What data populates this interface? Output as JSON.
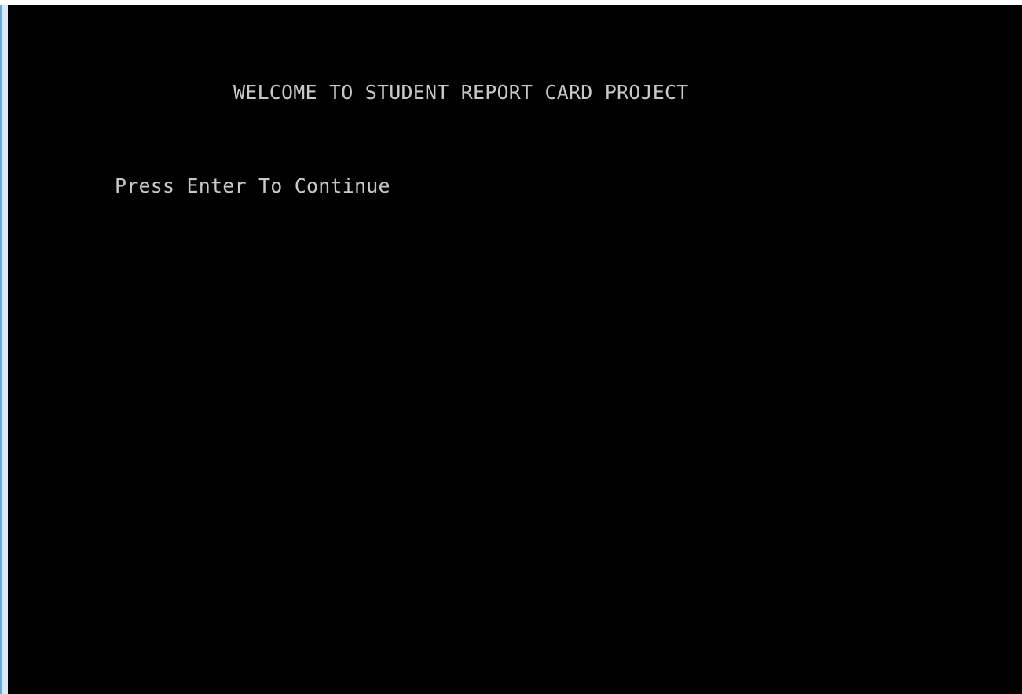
{
  "console": {
    "background_color": "#000000",
    "text_color": "#c8c8c8",
    "lines": {
      "welcome": "WELCOME TO STUDENT REPORT CARD PROJECT",
      "prompt": "Press Enter To Continue"
    }
  }
}
